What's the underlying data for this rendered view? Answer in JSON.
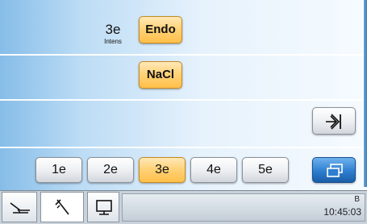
{
  "program": {
    "label": "3e",
    "sublabel": "Intens"
  },
  "buttons": {
    "endo": "Endo",
    "nacl": "NaCl"
  },
  "programs": [
    {
      "label": "1e",
      "selected": false
    },
    {
      "label": "2e",
      "selected": false
    },
    {
      "label": "3e",
      "selected": true
    },
    {
      "label": "4e",
      "selected": false
    },
    {
      "label": "5e",
      "selected": false
    }
  ],
  "status": {
    "letter": "B",
    "time": "10:45:03"
  },
  "icons": {
    "next": "arrow-into-icon",
    "windows": "overlapping-windows-icon",
    "tab1": "dental-chair-icon",
    "tab2": "dental-instrument-icon",
    "tab3": "monitor-icon"
  },
  "colors": {
    "selected": "#ffc04a",
    "accent": "#2e7ed0"
  }
}
